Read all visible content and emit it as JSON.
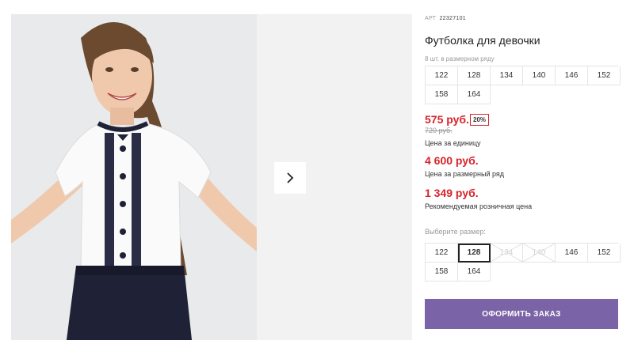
{
  "gallery": {
    "next_icon": "chevron-right-icon",
    "background": "#e9eaec"
  },
  "product": {
    "art_label": "АРТ",
    "art_number": "22327101",
    "title": "Футболка для девочки",
    "qty_note": "8 шт. в размерном ряду",
    "pack_sizes": [
      "122",
      "128",
      "134",
      "140",
      "146",
      "152",
      "158",
      "164"
    ],
    "price": "575 руб.",
    "discount": "20%",
    "old_price": "720 руб.",
    "price_caption": "Цена за единицу",
    "series_price": "4 600 руб.",
    "series_caption": "Цена за размерный ряд",
    "retail_price": "1 349 руб.",
    "retail_caption": "Рекомендуемая розничная цена"
  },
  "size_select": {
    "label": "Выберите размер:",
    "sizes": [
      {
        "label": "122",
        "state": "available"
      },
      {
        "label": "128",
        "state": "selected"
      },
      {
        "label": "134",
        "state": "disabled"
      },
      {
        "label": "140",
        "state": "disabled"
      },
      {
        "label": "146",
        "state": "available"
      },
      {
        "label": "152",
        "state": "available"
      },
      {
        "label": "158",
        "state": "available"
      },
      {
        "label": "164",
        "state": "available"
      }
    ]
  },
  "order_button": {
    "label": "ОФОРМИТЬ ЗАКАЗ",
    "color": "#7a64a7"
  },
  "colors": {
    "price_red": "#d8232a",
    "accent_purple": "#7a64a7"
  }
}
